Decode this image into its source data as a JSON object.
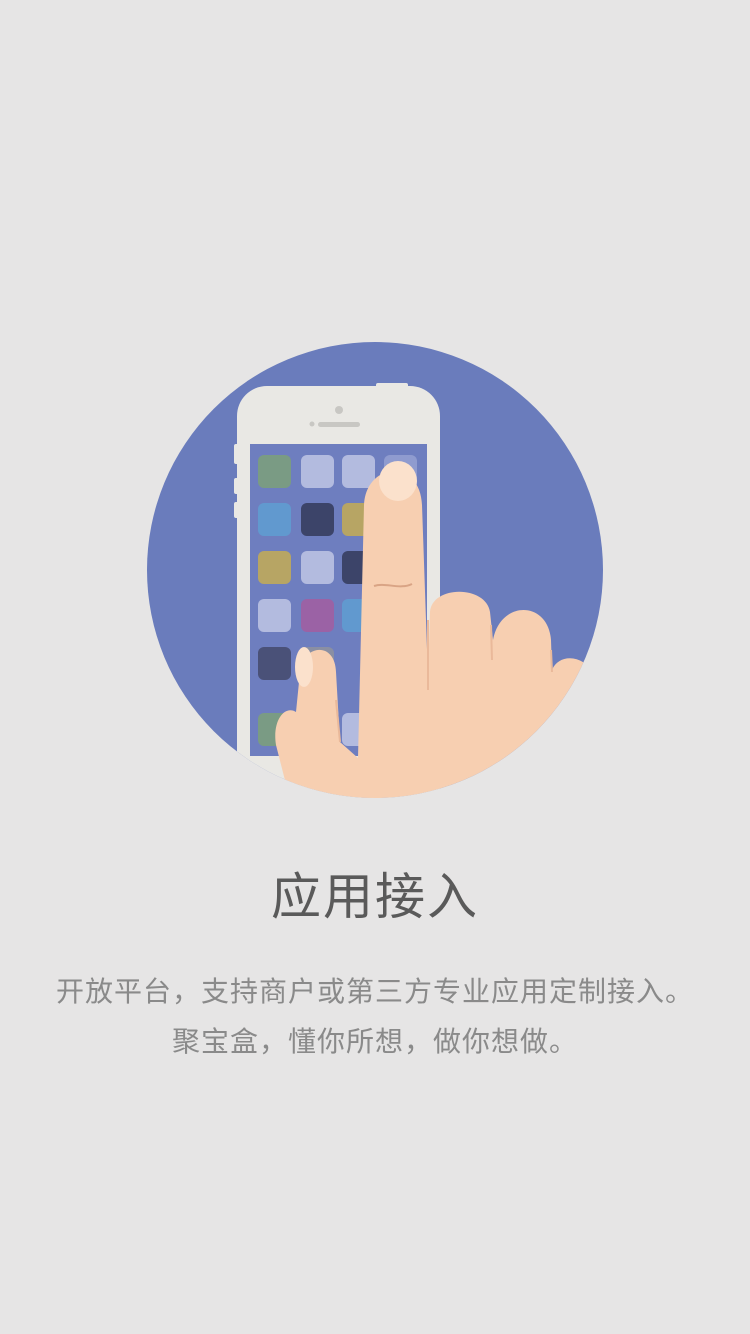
{
  "page": {
    "title": "应用接入",
    "description_line1": "开放平台，支持商户或第三方专业应用定制接入。",
    "description_line2": "聚宝盒，懂你所想，做你想做。"
  },
  "illustration": {
    "icon": "hand-tapping-phone-icon",
    "colors": {
      "background": "#e6e5e5",
      "circle": "#6a7cbc",
      "phone_body": "#e9e8e4",
      "phone_screen": "#6e7ebf",
      "skin": "#f7cfb1",
      "nail": "#fbe1cc"
    }
  }
}
